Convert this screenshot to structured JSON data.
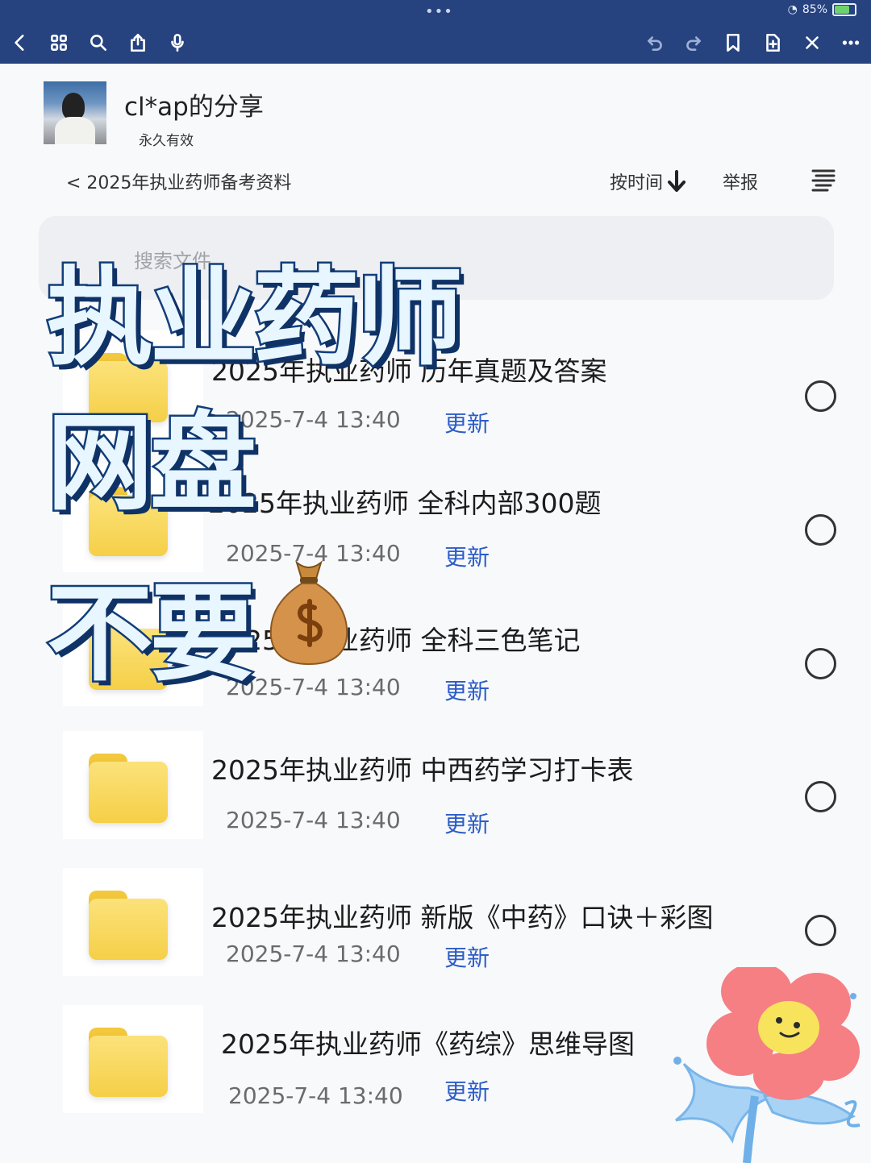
{
  "status_bar": {
    "more": "•••",
    "battery": "85%"
  },
  "toolbar": {
    "left_icons": [
      "back-icon",
      "grid-icon",
      "search-icon",
      "share-icon",
      "mic-icon"
    ],
    "right_icons": [
      "undo-icon",
      "redo-icon",
      "bookmark-icon",
      "add-page-icon",
      "close-icon",
      "more-icon"
    ]
  },
  "share": {
    "owner": "cl*ap的分享",
    "validity": "永久有效"
  },
  "nav": {
    "breadcrumb": "< 2025年执业药师备考资料",
    "sort_label": "按时间",
    "report_label": "举报"
  },
  "search": {
    "placeholder": "搜索文件"
  },
  "files": [
    {
      "name": "2025年执业药师 历年真题及答案",
      "date": "2025-7-4 13:40",
      "status": "更新"
    },
    {
      "name": "2025年执业药师  全科内部300题",
      "date": "2025-7-4 13:40",
      "status": "更新"
    },
    {
      "name": "2025年执业药师  全科三色笔记",
      "date": "2025-7-4 13:40",
      "status": "更新"
    },
    {
      "name": "2025年执业药师  中西药学习打卡表",
      "date": "2025-7-4 13:40",
      "status": "更新"
    },
    {
      "name": "2025年执业药师  新版《中药》口诀＋彩图",
      "date": "2025-7-4 13:40",
      "status": "更新"
    },
    {
      "name": "2025年执业药师《药综》思维导图",
      "date": "2025-7-4 13:40",
      "status": "更新"
    }
  ],
  "overlay": {
    "line1": "执业药师",
    "line2": "网盘",
    "line3": "不要"
  },
  "colors": {
    "toolbar_bg": "#26437f",
    "link_blue": "#2b5cc8",
    "folder_yellow": "#f5cf47"
  }
}
